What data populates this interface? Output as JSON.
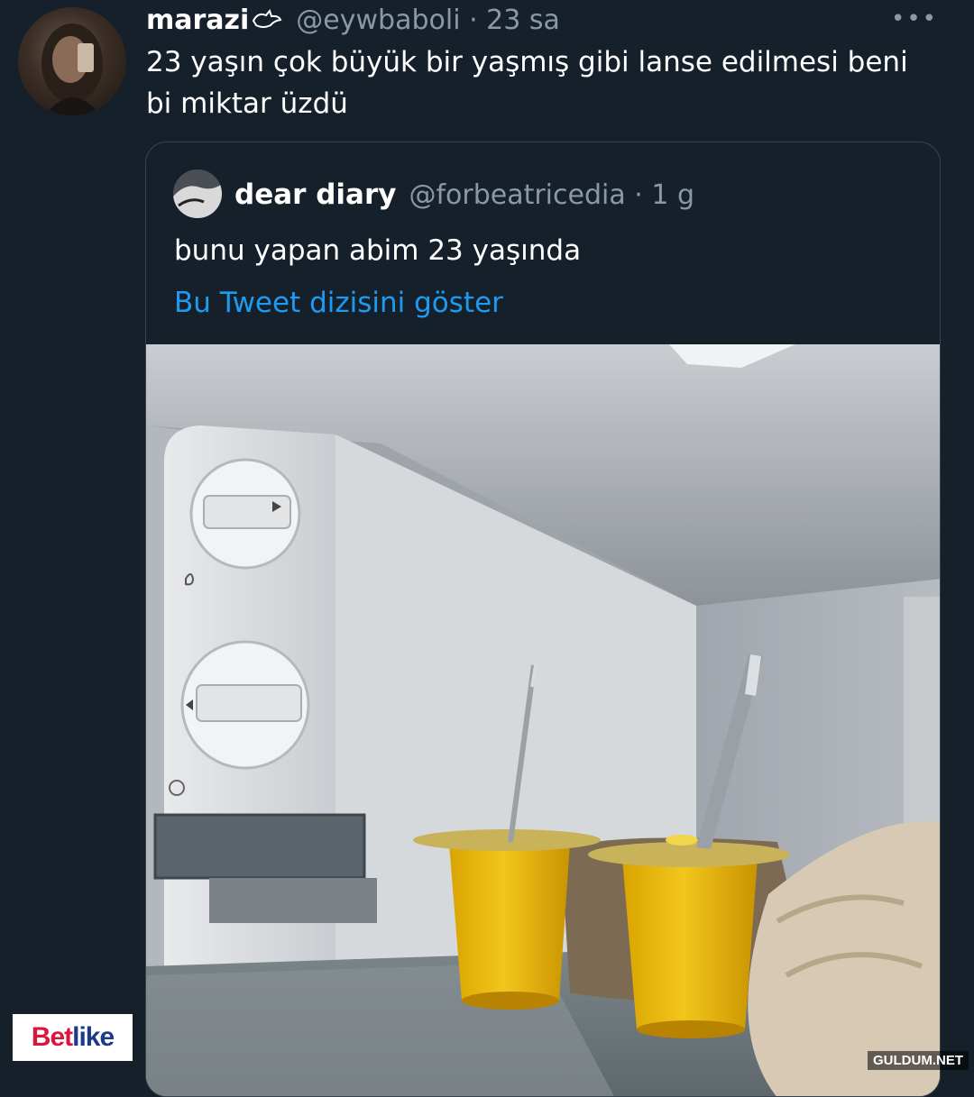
{
  "tweet": {
    "author_name": "marazi",
    "handle_and_time": "@eywbaboli · 23 sa",
    "text": "23 yaşın çok büyük bir yaşmış gibi lanse edilmesi beni bi miktar üzdü",
    "more_icon": "more-dots-icon"
  },
  "quoted_tweet": {
    "author_name": "dear diary",
    "handle_and_time": "@forbeatricedia · 1 g",
    "text": "bunu yapan abim 23 yaşında",
    "thread_link": "Bu Tweet dizisini göster"
  },
  "overlays": {
    "badge_left_a": "Bet",
    "badge_left_b": "like",
    "watermark": "GULDUM.NET"
  },
  "colors": {
    "background": "#15202b",
    "link": "#1d9bf0",
    "muted": "#8b98a5"
  }
}
